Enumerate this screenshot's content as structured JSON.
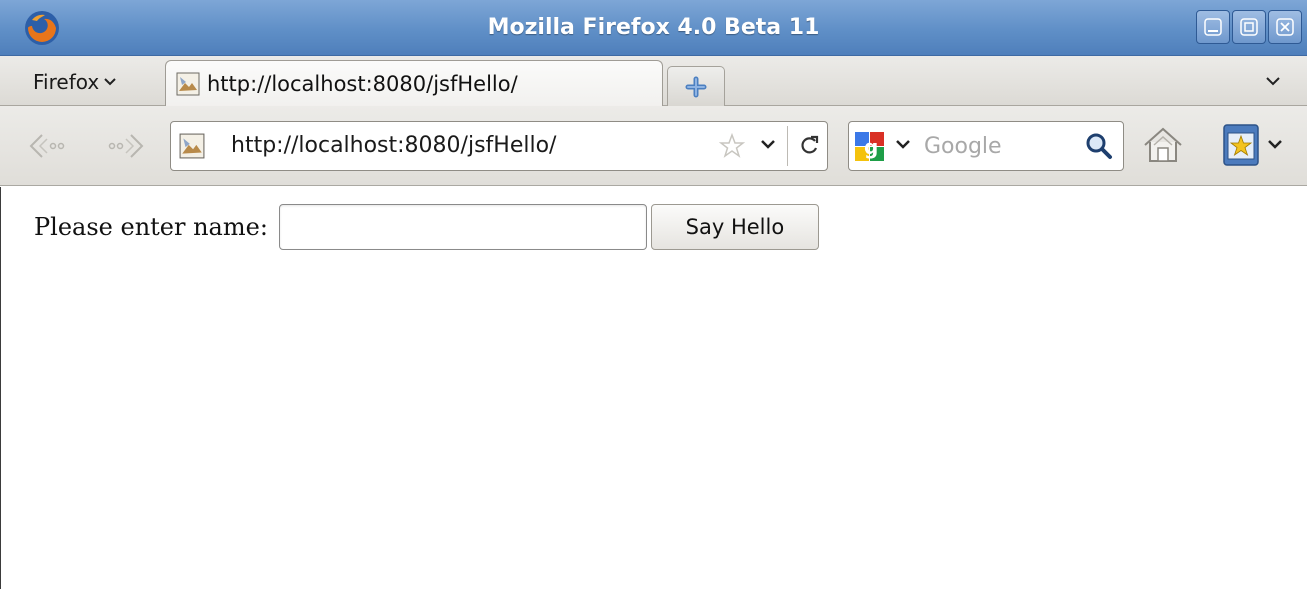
{
  "window": {
    "title": "Mozilla Firefox 4.0 Beta 11"
  },
  "tabbar": {
    "firefox_menu_label": "Firefox",
    "tabs": [
      {
        "title": "http://localhost:8080/jsfHello/"
      }
    ]
  },
  "navbar": {
    "url": "http://localhost:8080/jsfHello/",
    "search": {
      "placeholder": "Google"
    }
  },
  "page": {
    "form": {
      "label": "Please enter name:",
      "name_value": "",
      "submit_label": "Say Hello"
    }
  },
  "icons": {
    "app": "firefox-logo-icon",
    "favicon": "broken-image-icon",
    "back": "back-arrow-icon",
    "forward": "forward-arrow-icon",
    "bookmark_star": "star-icon",
    "reload": "reload-icon",
    "search_engine": "google-logo-icon",
    "search_go": "magnifier-icon",
    "home": "home-icon",
    "bookmarks": "bookmarks-icon",
    "new_tab": "plus-icon"
  },
  "colors": {
    "titlebar": "#5f8fc7",
    "toolbar": "#e6e4e0",
    "content_bg": "#ffffff"
  }
}
